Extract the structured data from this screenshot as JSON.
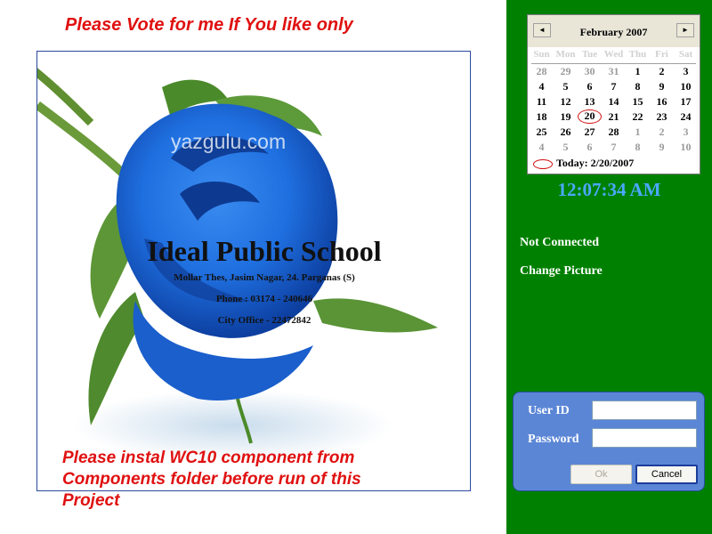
{
  "header": {
    "vote_text": "Please Vote for me If You like only"
  },
  "picture": {
    "watermark": "yazgulu.com",
    "school_name": "Ideal Public School",
    "address": "Mollar Thes, Jasim Nagar, 24. Parganas (S)",
    "phone": "Phone : 03174 - 240646",
    "city_office": "City Office - 22472842"
  },
  "footer": {
    "instal_text": "Please instal WC10 component from Components folder before run of this Project"
  },
  "calendar": {
    "prev_icon": "◄",
    "next_icon": "►",
    "month_title": "February 2007",
    "weekdays": [
      "Sun",
      "Mon",
      "Tue",
      "Wed",
      "Thu",
      "Fri",
      "Sat"
    ],
    "weeks": [
      [
        "28",
        "29",
        "30",
        "31",
        "1",
        "2",
        "3"
      ],
      [
        "4",
        "5",
        "6",
        "7",
        "8",
        "9",
        "10"
      ],
      [
        "11",
        "12",
        "13",
        "14",
        "15",
        "16",
        "17"
      ],
      [
        "18",
        "19",
        "20",
        "21",
        "22",
        "23",
        "24"
      ],
      [
        "25",
        "26",
        "27",
        "28",
        "1",
        "2",
        "3"
      ],
      [
        "4",
        "5",
        "6",
        "7",
        "8",
        "9",
        "10"
      ]
    ],
    "today_label": "Today: 2/20/2007"
  },
  "clock": "12:07:34 AM",
  "status": {
    "connection": "Not Connected",
    "change_picture": "Change Picture"
  },
  "login": {
    "user_id_label": "User ID",
    "password_label": "Password",
    "user_id_value": "",
    "password_value": "",
    "ok_label": "Ok",
    "cancel_label": "Cancel"
  },
  "colors": {
    "panel_green": "#008000",
    "warning_red": "#e01010",
    "clock_blue": "#4aa8ff",
    "login_blue": "#5b86d6",
    "rose_blue": "#1f6fe0"
  }
}
